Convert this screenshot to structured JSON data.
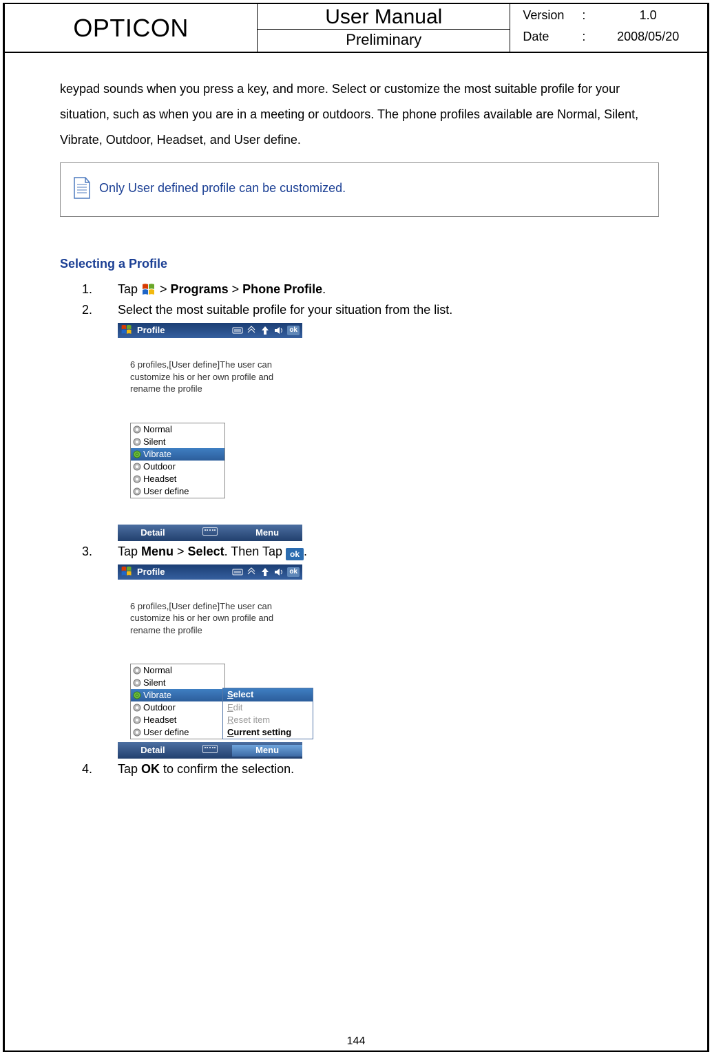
{
  "header": {
    "brand": "OPTICON",
    "title": "User Manual",
    "subtitle": "Preliminary",
    "version_label": "Version",
    "version_value": "1.0",
    "date_label": "Date",
    "date_value": "2008/05/20",
    "colon": ":"
  },
  "intro": "keypad sounds when you press a key, and more. Select or customize the most suitable profile for your situation, such as when you are in a meeting or outdoors. The phone profiles available are Normal, Silent, Vibrate, Outdoor, Headset, and User define.",
  "note": "Only User defined profile can be customized.",
  "subhead": "Selecting a Profile",
  "steps": {
    "s1_pre": "Tap ",
    "s1_mid": " > ",
    "s1_programs": "Programs",
    "s1_sep2": " > ",
    "s1_phoneprofile": "Phone Profile",
    "s1_end": ".",
    "s2": "Select the most suitable profile for your situation from the list.",
    "s3_pre": "Tap ",
    "s3_menu": "Menu",
    "s3_mid1": " > ",
    "s3_select": "Select",
    "s3_mid2": ". Then Tap ",
    "s3_end": ".",
    "s4_pre": "Tap ",
    "s4_ok": "OK",
    "s4_end": " to confirm the selection."
  },
  "screenshot": {
    "title": "Profile",
    "ok": "ok",
    "desc": "6 profiles,[User define]The user can customize his or her own profile and rename the profile",
    "profiles": [
      "Normal",
      "Silent",
      "Vibrate",
      "Outdoor",
      "Headset",
      "User define"
    ],
    "selected_index": 2,
    "soft_left": "Detail",
    "soft_right": "Menu",
    "popup": {
      "select_char": "S",
      "select_rest": "elect",
      "edit_char": "E",
      "edit_rest": "dit",
      "reset_char": "R",
      "reset_rest": "eset item",
      "current_char": "C",
      "current_rest": "urrent setting"
    }
  },
  "page_num": "144"
}
